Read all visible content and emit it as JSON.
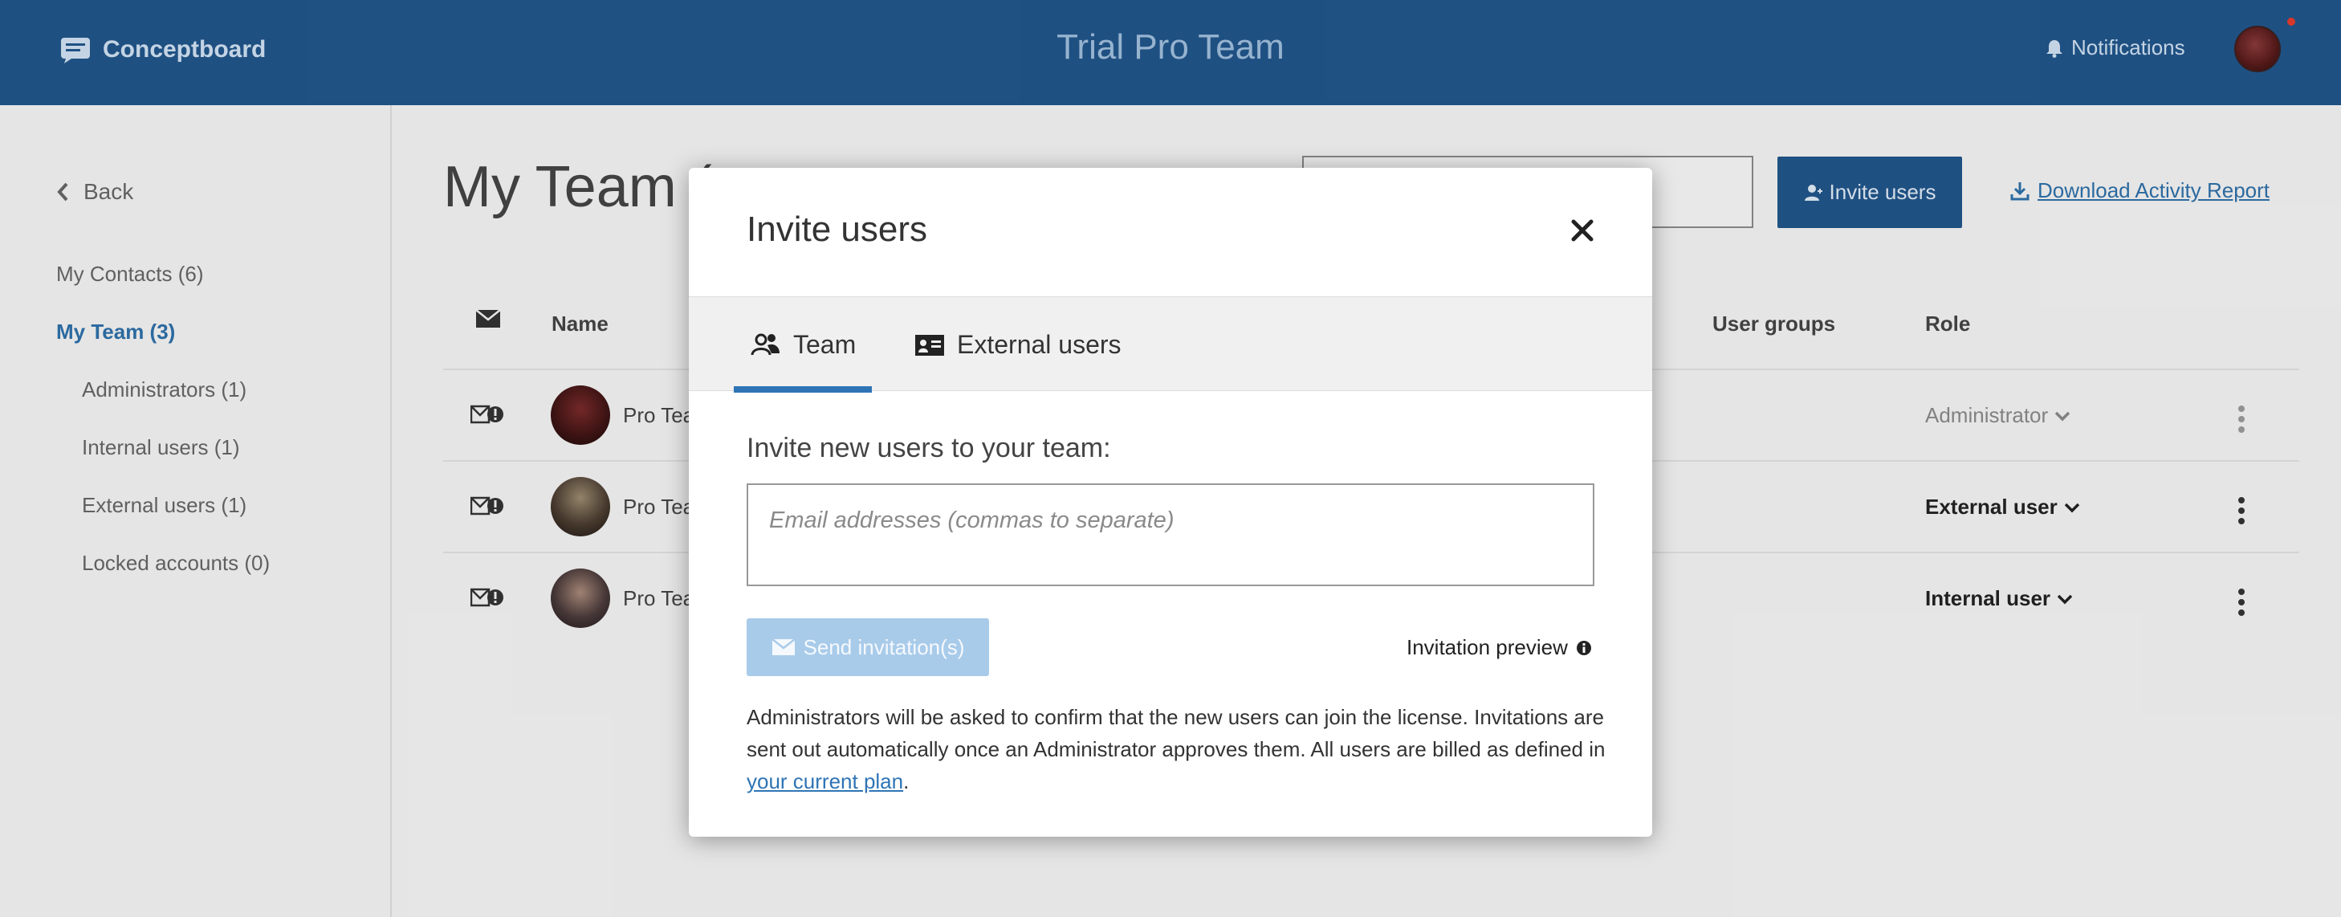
{
  "header": {
    "brand": "Conceptboard",
    "team_name": "Trial Pro Team",
    "notifications_label": "Notifications"
  },
  "sidebar": {
    "back_label": "Back",
    "items": [
      {
        "label": "My Contacts (6)"
      },
      {
        "label": "My Team (3)"
      },
      {
        "label": "Administrators (1)"
      },
      {
        "label": "Internal users (1)"
      },
      {
        "label": "External users (1)"
      },
      {
        "label": "Locked accounts (0)"
      }
    ]
  },
  "main": {
    "title": "My Team (",
    "invite_button": "Invite users",
    "download_link": "Download Activity Report",
    "columns": {
      "name": "Name",
      "user_groups": "User groups",
      "role": "Role"
    },
    "rows": [
      {
        "name": "Pro Tea",
        "role": "Administrator"
      },
      {
        "name": "Pro Tea",
        "role": "External user"
      },
      {
        "name": "Pro Tea",
        "role": "Internal user"
      }
    ]
  },
  "modal": {
    "title": "Invite users",
    "tabs": [
      {
        "label": "Team",
        "active": true
      },
      {
        "label": "External users",
        "active": false
      }
    ],
    "invite_label": "Invite new users to your team:",
    "email_placeholder": "Email addresses (commas to separate)",
    "send_button": "Send invitation(s)",
    "preview_label": "Invitation preview",
    "note_text": "Administrators will be asked to confirm that the new users can join the license. Invitations are sent out automatically once an Administrator approves them. All users are billed as defined in ",
    "note_link": "your current plan",
    "note_end": "."
  },
  "colors": {
    "header_bg": "#215589",
    "accent": "#2e74b5",
    "send_disabled": "#a9cbea"
  },
  "icons": [
    "conceptboard-logo-icon",
    "bell-icon",
    "chevron-left-icon",
    "envelope-icon",
    "user-plus-icon",
    "download-icon",
    "mail-alert-icon",
    "chevron-down-icon",
    "kebab-menu-icon",
    "close-icon",
    "team-icon",
    "id-card-icon",
    "info-icon"
  ]
}
